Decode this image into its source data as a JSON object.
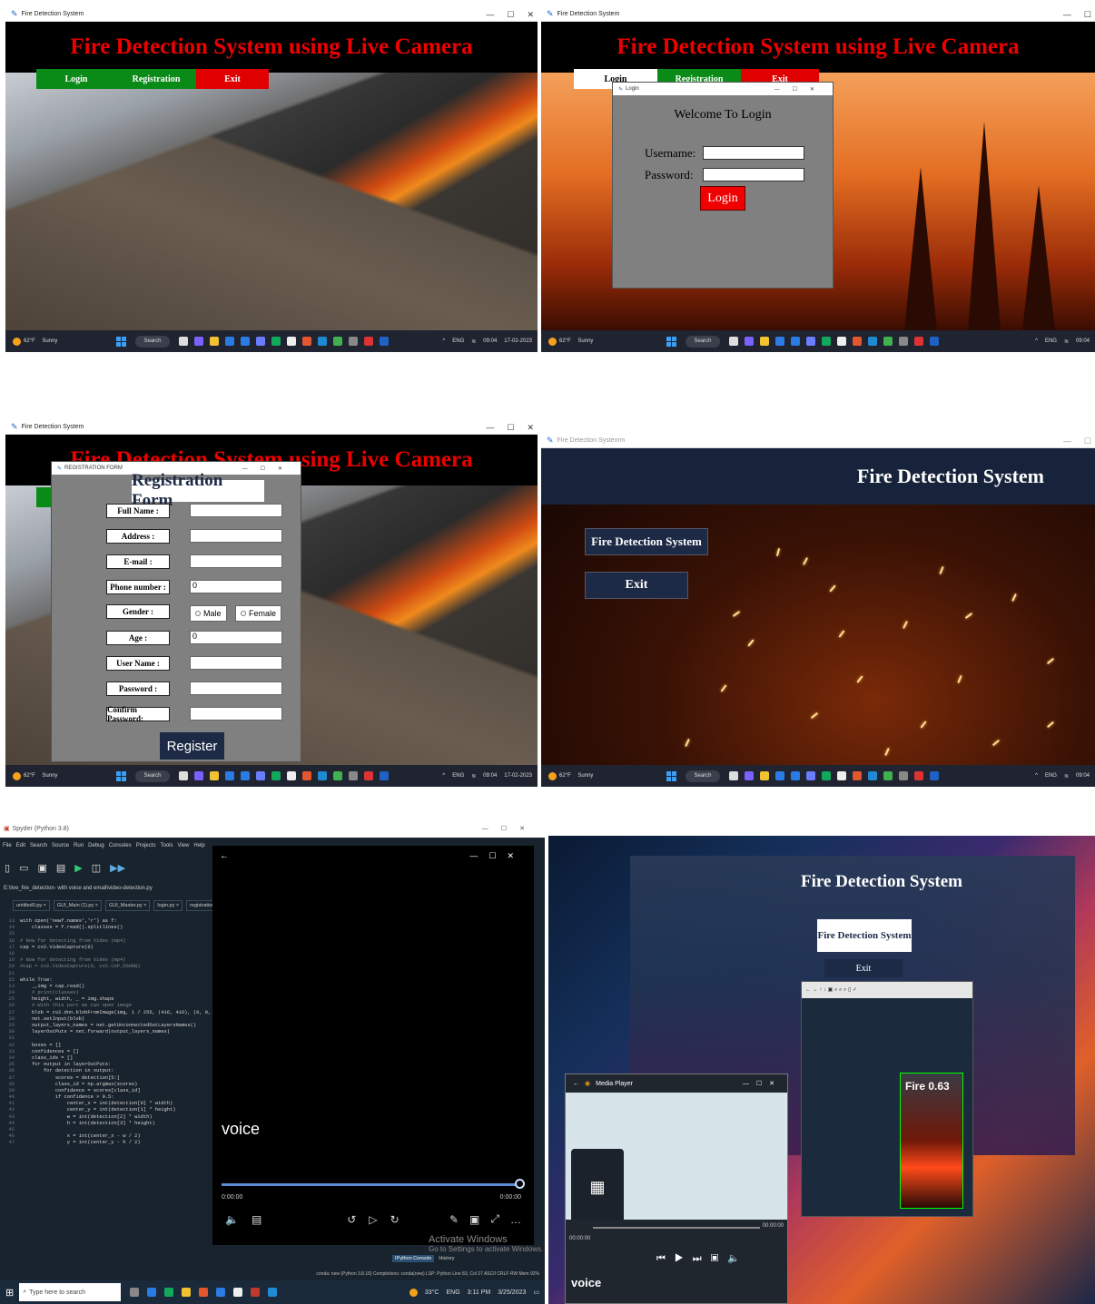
{
  "common": {
    "window_title": "Fire Detection System",
    "banner_title": "Fire Detection System using Live Camera",
    "weather_temp": "62°F",
    "weather_desc": "Sunny",
    "search_label": "Search",
    "lang": "ENG",
    "lang_region": "IN",
    "time": "09:04",
    "date": "17-02-2023"
  },
  "home_nav": {
    "login": "Login",
    "registration": "Registration",
    "exit": "Exit"
  },
  "login_dialog": {
    "title": "Login",
    "welcome": "Welcome To Login",
    "username_label": "Username:",
    "password_label": "Password:",
    "username_value": "",
    "password_value": "",
    "login_button": "Login"
  },
  "registration_dialog": {
    "title": "REGISTRATION FORM",
    "heading": "Registration Form",
    "fields": [
      {
        "label": "Full Name :",
        "value": ""
      },
      {
        "label": "Address :",
        "value": ""
      },
      {
        "label": "E-mail :",
        "value": ""
      },
      {
        "label": "Phone number :",
        "value": "0"
      },
      {
        "label": "Gender :",
        "value": ""
      },
      {
        "label": "Age :",
        "value": "0"
      },
      {
        "label": "User Name :",
        "value": ""
      },
      {
        "label": "Password :",
        "value": ""
      },
      {
        "label": "Confirm Password:",
        "value": ""
      }
    ],
    "gender_male": "Male",
    "gender_female": "Female",
    "register_button": "Register"
  },
  "fds_menu": {
    "window_title": "Fire Detection Systemm",
    "header": "Fire Detection System",
    "start_button": "Fire Detection System",
    "exit_button": "Exit"
  },
  "spyder": {
    "window_title": "Spyder (Python 3.8)",
    "menu": [
      "File",
      "Edit",
      "Search",
      "Source",
      "Run",
      "Debug",
      "Consoles",
      "Projects",
      "Tools",
      "View",
      "Help"
    ],
    "path": "E:\\live_fire_detection- with voice and email\\video-detection.py",
    "tabs": [
      "untitled0.py",
      "GUI_Main (1).py",
      "GUI_Master.py",
      "login.py",
      "registration.py"
    ],
    "code_lines": [
      {
        "n": "13",
        "t": "with open('newf.names','r') as f:"
      },
      {
        "n": "14",
        "t": "    classes = f.read().splitlines()"
      },
      {
        "n": "15",
        "t": ""
      },
      {
        "n": "16",
        "t": "# Now for detecting from Video (mp4)"
      },
      {
        "n": "17",
        "t": "cap = cv2.VideoCapture(0)"
      },
      {
        "n": "18",
        "t": ""
      },
      {
        "n": "19",
        "t": "# Now for detecting from Video (mp4)"
      },
      {
        "n": "20",
        "t": "#cap = cv2.VideoCapture(0, cv2.CAP_DSHOW)"
      },
      {
        "n": "21",
        "t": ""
      },
      {
        "n": "22",
        "t": "while True:"
      },
      {
        "n": "23",
        "t": "    _,img = cap.read()"
      },
      {
        "n": "24",
        "t": "    # print(classes)"
      },
      {
        "n": "25",
        "t": "    height, width, _ = img.shape"
      },
      {
        "n": "26",
        "t": "    # With this part we can open image"
      },
      {
        "n": "27",
        "t": "    blob = cv2.dnn.blobFromImage(img, 1 / 255, (416, 416), (0, 0,"
      },
      {
        "n": "28",
        "t": "    net.setInput(blob)"
      },
      {
        "n": "29",
        "t": "    output_layers_names = net.getUnconnectedOutLayersNames()"
      },
      {
        "n": "30",
        "t": "    layerOutPuts = net.forward(output_layers_names)"
      },
      {
        "n": "31",
        "t": ""
      },
      {
        "n": "32",
        "t": "    boxes = []"
      },
      {
        "n": "33",
        "t": "    confidences = []"
      },
      {
        "n": "34",
        "t": "    class_ids = []"
      },
      {
        "n": "35",
        "t": "    for output in layerOutPuts:"
      },
      {
        "n": "36",
        "t": "        for detection in output:"
      },
      {
        "n": "37",
        "t": "            scores = detection[5:]"
      },
      {
        "n": "38",
        "t": "            class_id = np.argmax(scores)"
      },
      {
        "n": "39",
        "t": "            confidence = scores[class_id]"
      },
      {
        "n": "40",
        "t": "            if confidence > 0.5:"
      },
      {
        "n": "41",
        "t": "                center_x = int(detection[0] * width)"
      },
      {
        "n": "42",
        "t": "                center_y = int(detection[1] * height)"
      },
      {
        "n": "43",
        "t": "                w = int(detection[2] * width)"
      },
      {
        "n": "44",
        "t": "                h = int(detection[3] * height)"
      },
      {
        "n": "45",
        "t": ""
      },
      {
        "n": "46",
        "t": "                x = int(center_x - w / 2)"
      },
      {
        "n": "47",
        "t": "                y = int(center_y - h / 2)"
      }
    ],
    "console_tabs": [
      "IPython Console",
      "History"
    ],
    "status": "conda: new (Python 3.8.16)   Completions: conda(new)   LSP: Python   Line 83, Col 27   ASCII   CRLF   RW   Mem 92%",
    "taskbar_search": "Type here to search",
    "temp": "33°C",
    "time": "3:11 PM",
    "date": "3/25/2023"
  },
  "media_player": {
    "caption": "voice",
    "time_start": "0:00:00",
    "time_end": "0:00:00",
    "activate_line1": "Activate Windows",
    "activate_line2": "Go to Settings to activate Windows."
  },
  "photo": {
    "header": "Fire Detection System",
    "button": "Fire Detection System",
    "exit_partial": "Exit",
    "detection_label": "Fire 0.63",
    "media_title": "Media Player",
    "media_time_start": "00:00:00",
    "media_time_end": "00:00:00",
    "media_caption": "voice"
  }
}
